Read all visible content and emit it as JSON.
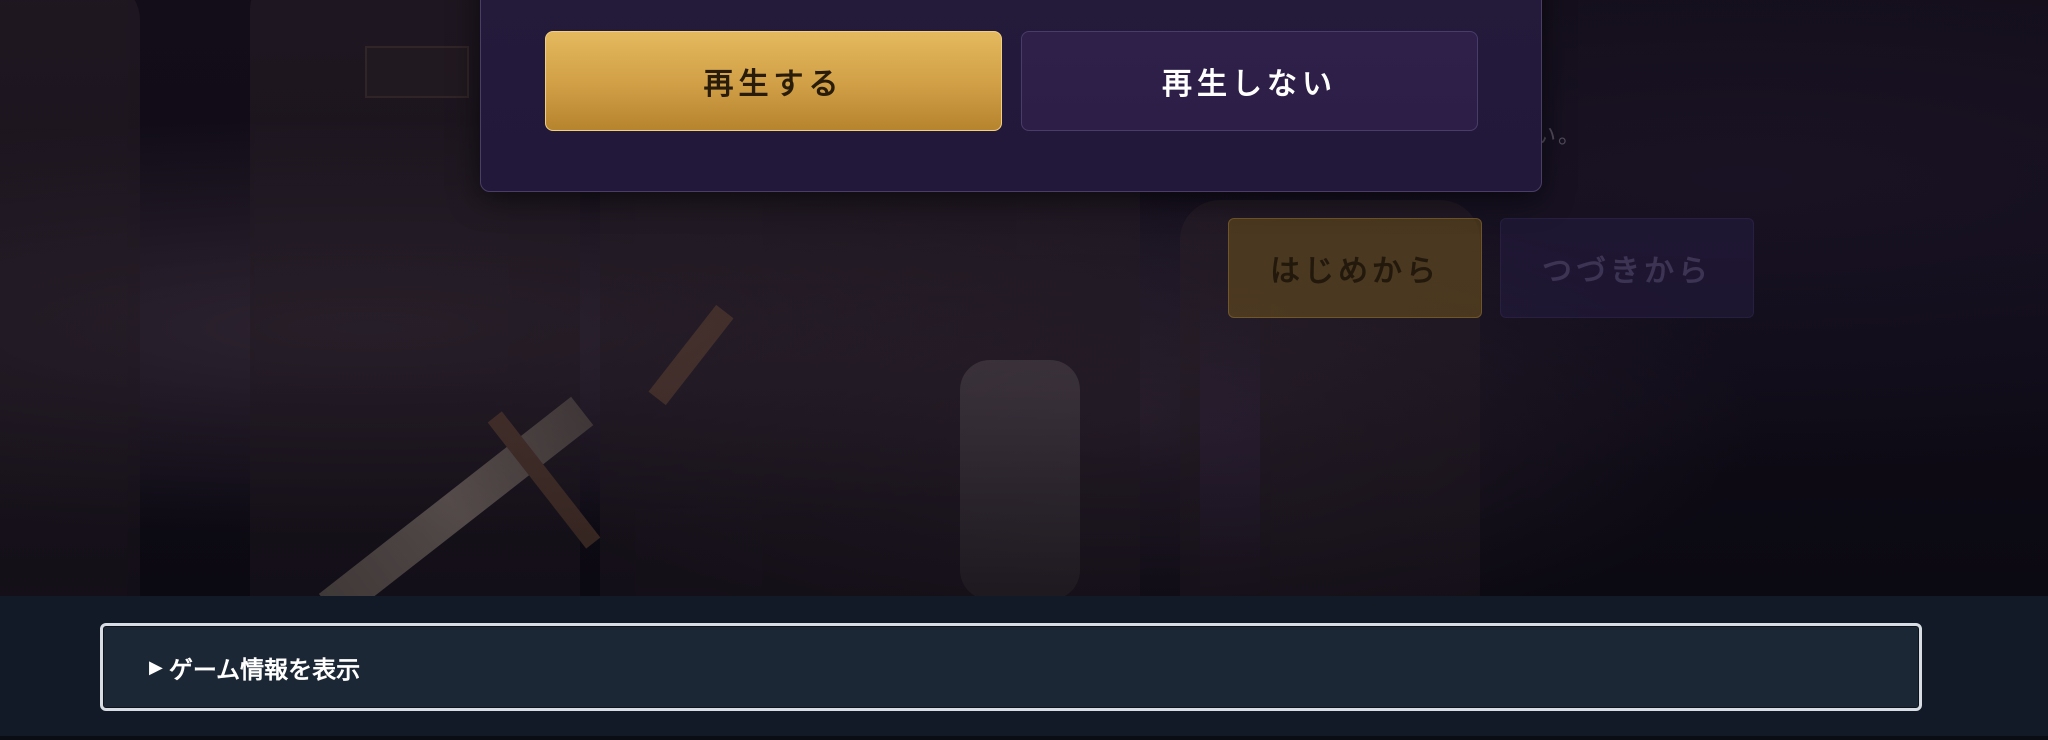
{
  "dialog": {
    "play_label": "再生する",
    "no_play_label": "再生しない"
  },
  "background_screen": {
    "hint_fragment": "い。",
    "start_label": "はじめから",
    "continue_label": "つづきから"
  },
  "game_info": {
    "toggle_icon": "▶",
    "toggle_label": "ゲーム情報を表示"
  },
  "colors": {
    "primary_button": "#d2a148",
    "secondary_button": "#2c1e46",
    "dialog_bg": "#241a3a",
    "bottom_bar": "#111a26"
  }
}
